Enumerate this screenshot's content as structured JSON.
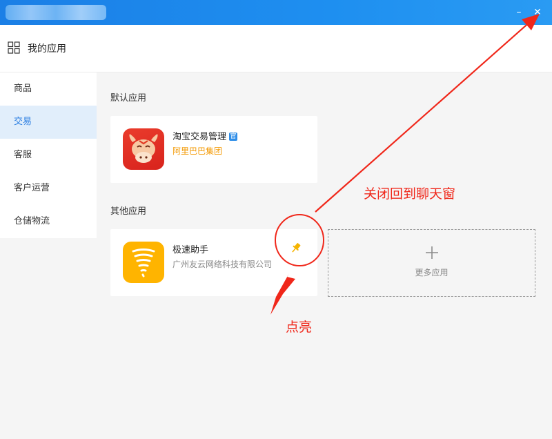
{
  "window": {
    "minimize_glyph": "–",
    "close_glyph": "✕"
  },
  "header": {
    "title": "我的应用",
    "icon": "grid-icon"
  },
  "sidebar": {
    "items": [
      {
        "label": "商品",
        "active": false
      },
      {
        "label": "交易",
        "active": true
      },
      {
        "label": "客服",
        "active": false
      },
      {
        "label": "客户运营",
        "active": false
      },
      {
        "label": "仓储物流",
        "active": false
      }
    ]
  },
  "sections": {
    "default_title": "默认应用",
    "other_title": "其他应用"
  },
  "default_app": {
    "name": "淘宝交易管理",
    "badge": "官",
    "publisher": "阿里巴巴集团",
    "icon": "taobao-cow-icon"
  },
  "other_app": {
    "name": "极速助手",
    "publisher": "广州友云网络科技有限公司",
    "icon": "tornado-icon",
    "pin_icon": "pin-icon"
  },
  "more_apps": {
    "label": "更多应用",
    "icon": "plus-icon"
  },
  "annotations": {
    "close_note": "关闭回到聊天窗",
    "light_note": "点亮",
    "color": "#f0271a"
  },
  "colors": {
    "titlebar": "#1b7fe6",
    "active_item_bg": "#e1eefb",
    "active_item_text": "#2a7de1",
    "publisher_orange": "#f39800",
    "icon_red": "#d8231c",
    "icon_yellow": "#ffb400"
  }
}
